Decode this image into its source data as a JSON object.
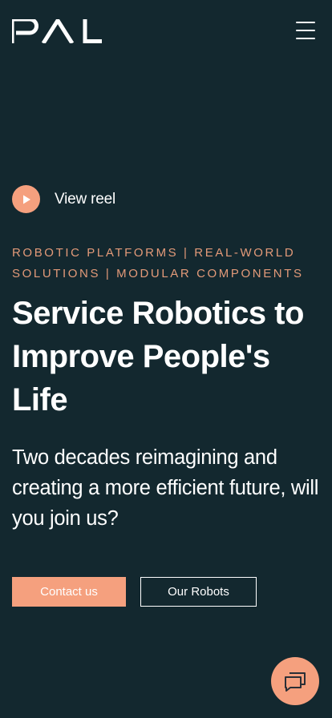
{
  "header": {
    "logo_text": "PAL",
    "menu_icon": "hamburger-menu-icon"
  },
  "hero": {
    "reel": {
      "icon": "play-icon",
      "label": "View reel"
    },
    "eyebrow": "ROBOTIC PLATFORMS | REAL-WORLD SOLUTIONS | MODULAR COMPONENTS",
    "headline": "Service Robotics to Improve People's Life",
    "subtitle": "Two decades reimagining and creating a more efficient future, will you join us?",
    "buttons": {
      "contact_label": "Contact us",
      "robots_label": "Our Robots"
    }
  },
  "chat": {
    "icon": "chat-bubbles-icon"
  },
  "colors": {
    "background": "#13282f",
    "accent": "#f5a07e",
    "eyebrow": "#e39a79",
    "text": "#ffffff"
  }
}
